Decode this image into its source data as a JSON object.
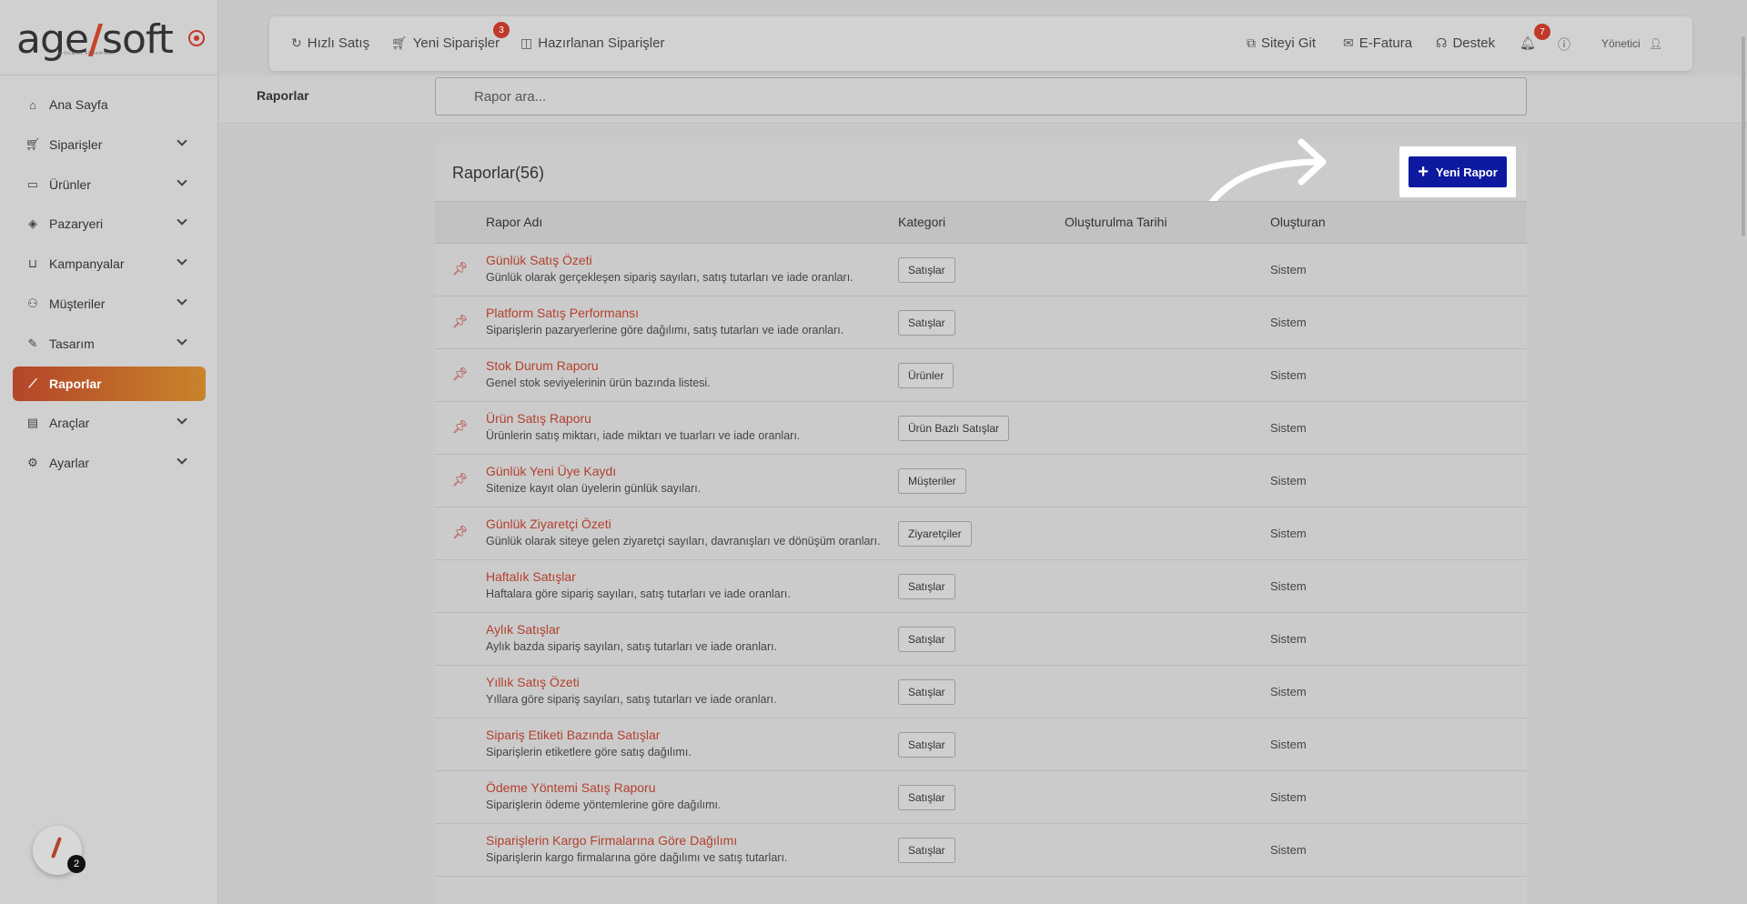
{
  "brand": {
    "logo_main": "age",
    "logo_slash": "/",
    "logo_end": "soft",
    "logo_sub": "e-ticaret sistemleri"
  },
  "sidebar": {
    "items": [
      {
        "label": "Ana Sayfa",
        "icon": "home-icon",
        "chevron": false
      },
      {
        "label": "Siparişler",
        "icon": "cart-icon",
        "chevron": true
      },
      {
        "label": "Ürünler",
        "icon": "book-icon",
        "chevron": true
      },
      {
        "label": "Pazaryeri",
        "icon": "box-icon",
        "chevron": true
      },
      {
        "label": "Kampanyalar",
        "icon": "basket-icon",
        "chevron": true
      },
      {
        "label": "Müşteriler",
        "icon": "user-icon",
        "chevron": true
      },
      {
        "label": "Tasarım",
        "icon": "pen-icon",
        "chevron": true
      },
      {
        "label": "Raporlar",
        "icon": "chart-icon",
        "chevron": false,
        "active": true
      },
      {
        "label": "Araçlar",
        "icon": "clipboard-icon",
        "chevron": true
      },
      {
        "label": "Ayarlar",
        "icon": "gear-icon",
        "chevron": true
      }
    ],
    "help_badge": "2"
  },
  "topbar": {
    "quick_sale": "Hızlı Satış",
    "new_orders": "Yeni Siparişler",
    "new_orders_badge": "3",
    "preparing_orders": "Hazırlanan Siparişler",
    "visit_site": "Siteyi Git",
    "einvoice": "E-Fatura",
    "support": "Destek",
    "notifications_badge": "7",
    "user": "Yönetici"
  },
  "page": {
    "title": "Raporlar",
    "search_placeholder": "Rapor ara...",
    "card_title": "Raporlar(56)",
    "new_button": "Yeni Rapor"
  },
  "table": {
    "headers": {
      "name": "Rapor Adı",
      "category": "Kategori",
      "created_at": "Oluşturulma Tarihi",
      "creator": "Oluşturan"
    },
    "rows": [
      {
        "name": "Günlük Satış Özeti",
        "desc": "Günlük olarak gerçekleşen sipariş sayıları, satış tutarları ve iade oranları.",
        "category": "Satışlar",
        "creator": "Sistem",
        "pinned": true
      },
      {
        "name": "Platform Satış Performansı",
        "desc": "Siparişlerin pazaryerlerine göre dağılımı, satış tutarları ve iade oranları.",
        "category": "Satışlar",
        "creator": "Sistem",
        "pinned": true
      },
      {
        "name": "Stok Durum Raporu",
        "desc": "Genel stok seviyelerinin ürün bazında listesi.",
        "category": "Ürünler",
        "creator": "Sistem",
        "pinned": true
      },
      {
        "name": "Ürün Satış Raporu",
        "desc": "Ürünlerin satış miktarı, iade miktarı ve tuarları ve iade oranları.",
        "category": "Ürün Bazlı Satışlar",
        "creator": "Sistem",
        "pinned": true
      },
      {
        "name": "Günlük Yeni Üye Kaydı",
        "desc": "Sitenize kayıt olan üyelerin günlük sayıları.",
        "category": "Müşteriler",
        "creator": "Sistem",
        "pinned": true
      },
      {
        "name": "Günlük Ziyaretçi Özeti",
        "desc": "Günlük olarak siteye gelen ziyaretçi sayıları, davranışları ve dönüşüm oranları.",
        "category": "Ziyaretçiler",
        "creator": "Sistem",
        "pinned": true
      },
      {
        "name": "Haftalık Satışlar",
        "desc": "Haftalara göre sipariş sayıları, satış tutarları ve iade oranları.",
        "category": "Satışlar",
        "creator": "Sistem",
        "pinned": false
      },
      {
        "name": "Aylık Satışlar",
        "desc": "Aylık bazda sipariş sayıları, satış tutarları ve iade oranları.",
        "category": "Satışlar",
        "creator": "Sistem",
        "pinned": false
      },
      {
        "name": "Yıllık Satış Özeti",
        "desc": "Yıllara göre sipariş sayıları, satış tutarları ve iade oranları.",
        "category": "Satışlar",
        "creator": "Sistem",
        "pinned": false
      },
      {
        "name": "Sipariş Etiketi Bazında Satışlar",
        "desc": "Siparişlerin etiketlere göre satış dağılımı.",
        "category": "Satışlar",
        "creator": "Sistem",
        "pinned": false
      },
      {
        "name": "Ödeme Yöntemi Satış Raporu",
        "desc": "Siparişlerin ödeme yöntemlerine göre dağılımı.",
        "category": "Satışlar",
        "creator": "Sistem",
        "pinned": false
      },
      {
        "name": "Siparişlerin Kargo Firmalarına Göre Dağılımı",
        "desc": "Siparişlerin kargo firmalarına göre dağılımı ve satış tutarları.",
        "category": "Satışlar",
        "creator": "Sistem",
        "pinned": false
      }
    ]
  }
}
